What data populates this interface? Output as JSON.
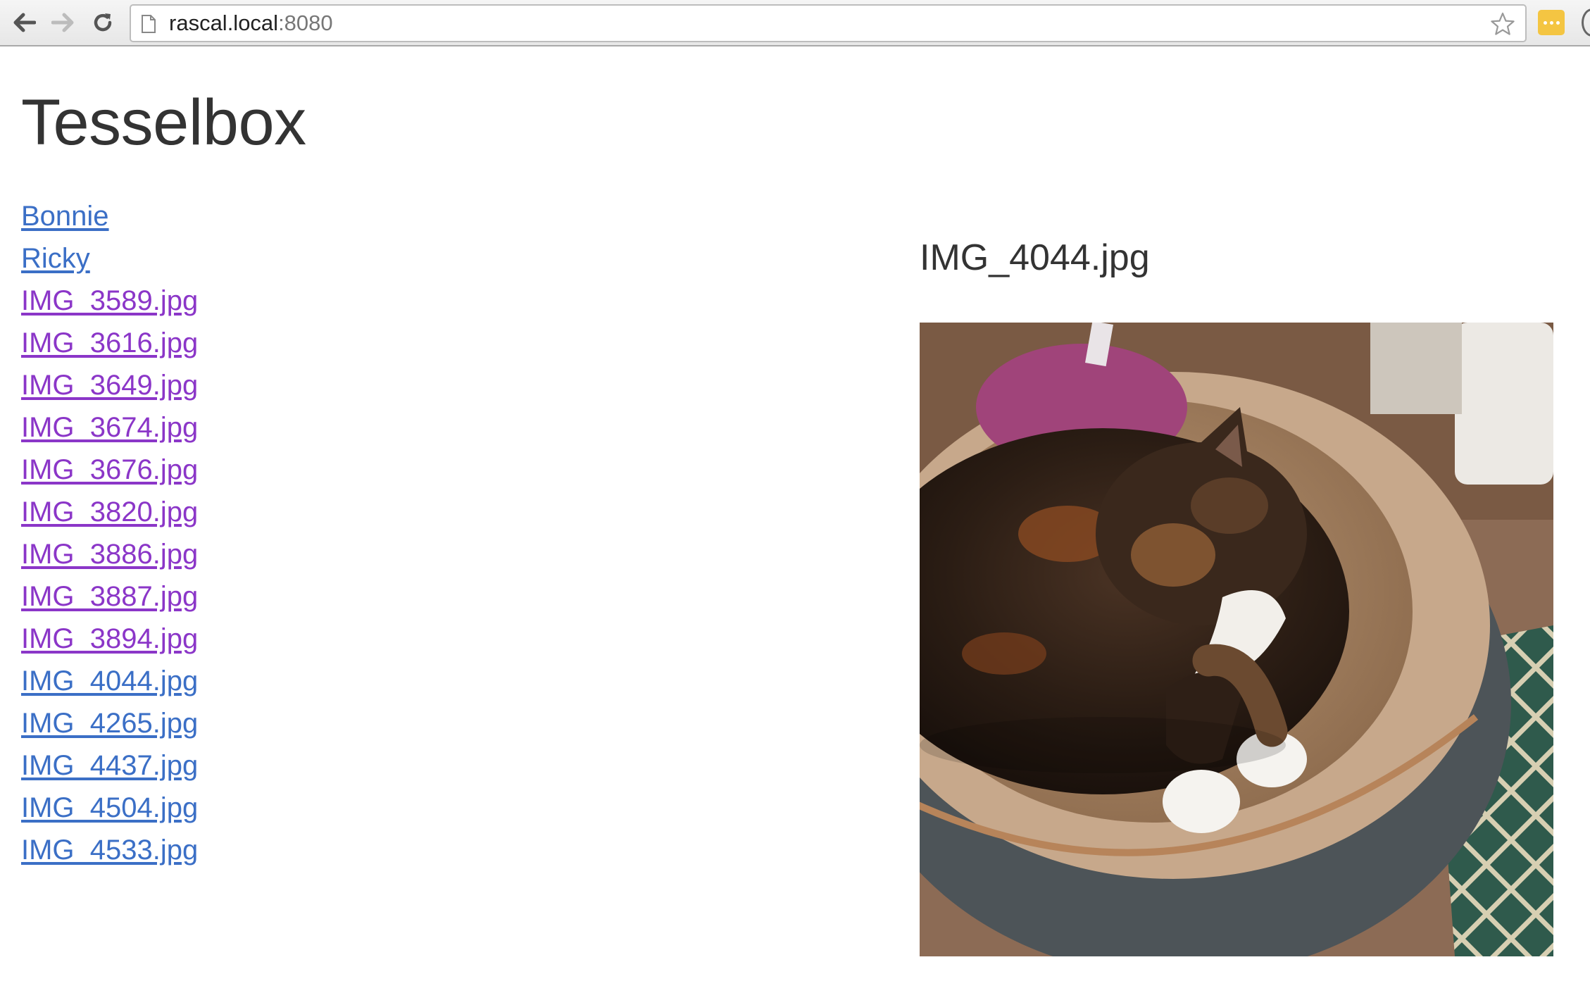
{
  "browser": {
    "url_host": "rascal.local",
    "url_port": ":8080"
  },
  "page": {
    "title": "Tesselbox",
    "links": [
      {
        "label": "Bonnie",
        "state": "unvisited"
      },
      {
        "label": "Ricky",
        "state": "unvisited"
      },
      {
        "label": "IMG_3589.jpg",
        "state": "visited"
      },
      {
        "label": "IMG_3616.jpg",
        "state": "visited"
      },
      {
        "label": "IMG_3649.jpg",
        "state": "visited"
      },
      {
        "label": "IMG_3674.jpg",
        "state": "visited"
      },
      {
        "label": "IMG_3676.jpg",
        "state": "visited"
      },
      {
        "label": "IMG_3820.jpg",
        "state": "visited"
      },
      {
        "label": "IMG_3886.jpg",
        "state": "visited"
      },
      {
        "label": "IMG_3887.jpg",
        "state": "visited"
      },
      {
        "label": "IMG_3894.jpg",
        "state": "visited"
      },
      {
        "label": "IMG_4044.jpg",
        "state": "unvisited"
      },
      {
        "label": "IMG_4265.jpg",
        "state": "unvisited"
      },
      {
        "label": "IMG_4437.jpg",
        "state": "unvisited"
      },
      {
        "label": "IMG_4504.jpg",
        "state": "unvisited"
      },
      {
        "label": "IMG_4533.jpg",
        "state": "unvisited"
      }
    ],
    "preview": {
      "filename": "IMG_4044.jpg"
    }
  },
  "colors": {
    "link": "#3b6fc6",
    "link_visited": "#8b36c8",
    "text": "#333333"
  },
  "icons": [
    "back-arrow-icon",
    "forward-arrow-icon",
    "reload-icon",
    "page-icon",
    "star-icon",
    "extension-icon"
  ]
}
